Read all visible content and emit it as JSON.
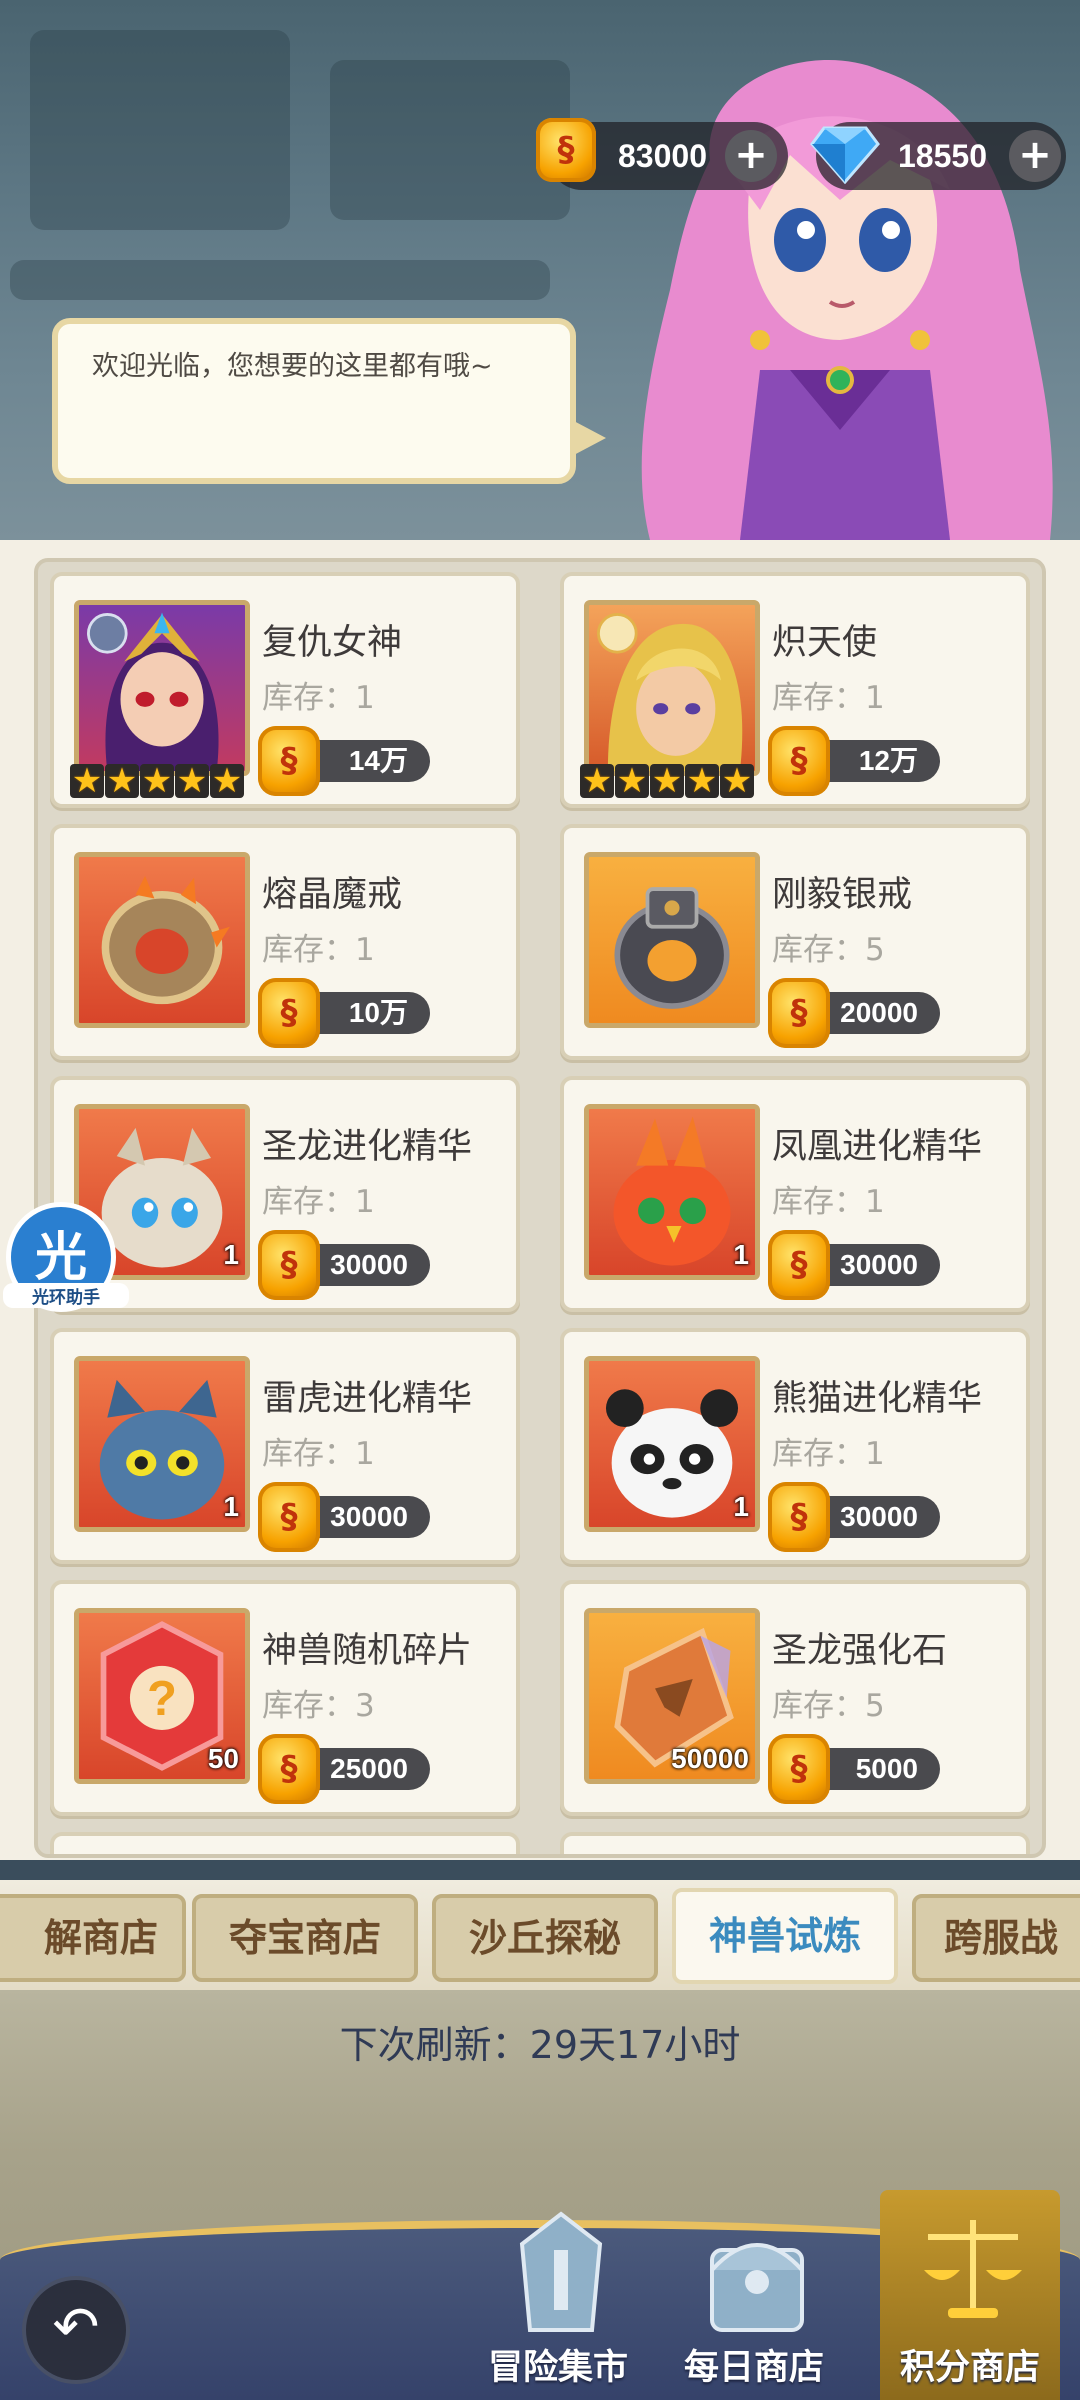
{
  "header": {
    "gold": "83000",
    "diamonds": "18550",
    "plus": "+",
    "gold_glyph": "§",
    "speech": "欢迎光临，您想要的这里都有哦~"
  },
  "labels": {
    "stock_prefix": "库存："
  },
  "items": [
    {
      "name": "复仇女神",
      "stock": "1",
      "price": "14万",
      "stars": 5,
      "icon": "hero-nemesis-portrait",
      "count": ""
    },
    {
      "name": "炽天使",
      "stock": "1",
      "price": "12万",
      "stars": 5,
      "icon": "hero-seraph-portrait",
      "count": ""
    },
    {
      "name": "熔晶魔戒",
      "stock": "1",
      "price": "10万",
      "icon": "lava-crystal-ring-icon",
      "count": ""
    },
    {
      "name": "刚毅银戒",
      "stock": "5",
      "price": "20000",
      "icon": "silver-ring-icon",
      "count": ""
    },
    {
      "name": "圣龙进化精华",
      "stock": "1",
      "price": "30000",
      "icon": "holy-dragon-pet-icon",
      "count": "1"
    },
    {
      "name": "凤凰进化精华",
      "stock": "1",
      "price": "30000",
      "icon": "phoenix-pet-icon",
      "count": "1"
    },
    {
      "name": "雷虎进化精华",
      "stock": "1",
      "price": "30000",
      "icon": "thunder-tiger-pet-icon",
      "count": "1"
    },
    {
      "name": "熊猫进化精华",
      "stock": "1",
      "price": "30000",
      "icon": "panda-pet-icon",
      "count": "1"
    },
    {
      "name": "神兽随机碎片",
      "stock": "3",
      "price": "25000",
      "icon": "random-beast-shard-icon",
      "count": "50"
    },
    {
      "name": "圣龙强化石",
      "stock": "5",
      "price": "5000",
      "icon": "dragon-enhance-stone-icon",
      "count": "50000"
    }
  ],
  "tabs": [
    "解商店",
    "夺宝商店",
    "沙丘探秘",
    "神兽试炼",
    "跨服战"
  ],
  "active_tab": "神兽试炼",
  "refresh_text": "下次刷新：29天17小时",
  "nav": {
    "back": "↶",
    "items": [
      "冒险集市",
      "每日商店",
      "积分商店"
    ],
    "active": "积分商店"
  },
  "helper": {
    "big": "光",
    "small": "光环助手"
  }
}
